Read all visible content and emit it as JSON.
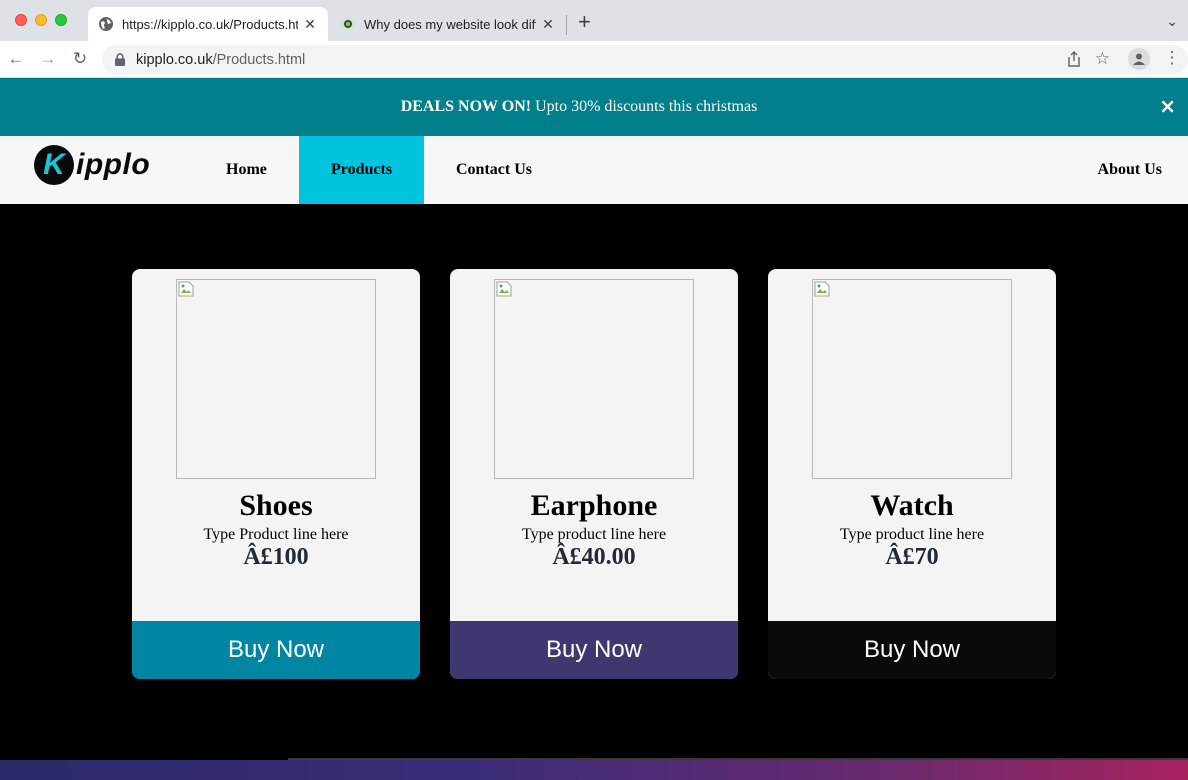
{
  "browser": {
    "tabs": [
      {
        "title": "https://kipplo.co.uk/Products.html",
        "active": true,
        "icon": "globe-icon"
      },
      {
        "title": "Why does my website look diffe",
        "active": false,
        "icon": "site-favicon-icon"
      }
    ],
    "url_host": "kipplo.co.uk",
    "url_path": "/Products.html"
  },
  "banner": {
    "bold": "DEALS NOW ON!",
    "text": " Upto 30% discounts this christmas",
    "close": "×",
    "bg_color": "#017f8a"
  },
  "logo": {
    "initial": "K",
    "text": "ipplo",
    "accent_color": "#18c6d6"
  },
  "nav": {
    "home": "Home",
    "products": "Products",
    "contact": "Contact Us",
    "about": "About Us",
    "active_color": "#00c4dd"
  },
  "products": [
    {
      "name": "Shoes",
      "line": "Type Product line here",
      "price": "Â£100",
      "button": "Buy Now",
      "button_color": "#0086a3"
    },
    {
      "name": "Earphone",
      "line": "Type product line here",
      "price": "Â£40.00",
      "button": "Buy Now",
      "button_color": "#3d3870"
    },
    {
      "name": "Watch",
      "line": "Type product line here",
      "price": "Â£70",
      "button": "Buy Now",
      "button_color": "#0a0a0a"
    }
  ]
}
